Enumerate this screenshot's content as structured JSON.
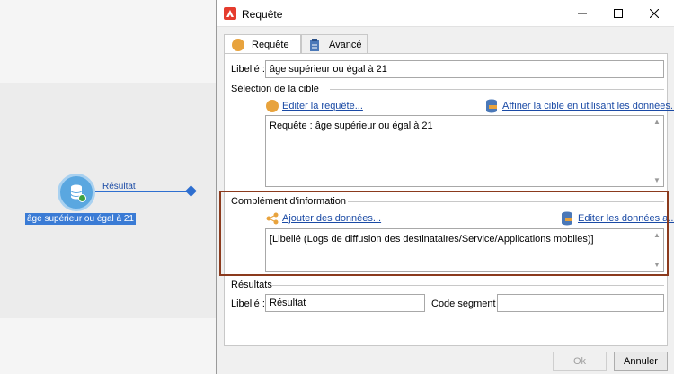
{
  "canvas": {
    "result_label": "Résultat",
    "node_label": "âge supérieur ou égal à 21"
  },
  "dialog": {
    "title": "Requête",
    "controls": {
      "minimize": "minimize",
      "maximize": "maximize",
      "close": "close"
    },
    "tabs": [
      {
        "label": "Requête",
        "icon": "query-circle-icon",
        "active": true
      },
      {
        "label": "Avancé",
        "icon": "clipboard-icon",
        "active": false
      }
    ],
    "libelle_label": "Libellé :",
    "libelle_value": "âge supérieur ou égal à 21",
    "target_section": {
      "title": "Sélection de la cible",
      "edit_query_link": "Editer la requête...",
      "refine_link": "Affiner la cible en utilisant les données...",
      "query_text": "Requête : âge supérieur ou égal à 21"
    },
    "complement_section": {
      "title": "Complément d'information",
      "add_data_link": "Ajouter des données...",
      "edit_data_link": "Editer les données a...",
      "data_text": "[Libellé (Logs de diffusion des destinataires/Service/Applications mobiles)]"
    },
    "results_section": {
      "title": "Résultats",
      "libelle_label": "Libellé :",
      "libelle_value": "Résultat",
      "segment_label": "Code segment :",
      "segment_value": ""
    },
    "buttons": {
      "ok": "Ok",
      "cancel": "Annuler"
    },
    "colors": {
      "highlight": "#8b3a1d",
      "link": "#1a4aa5",
      "accent": "#e53c2e"
    }
  }
}
